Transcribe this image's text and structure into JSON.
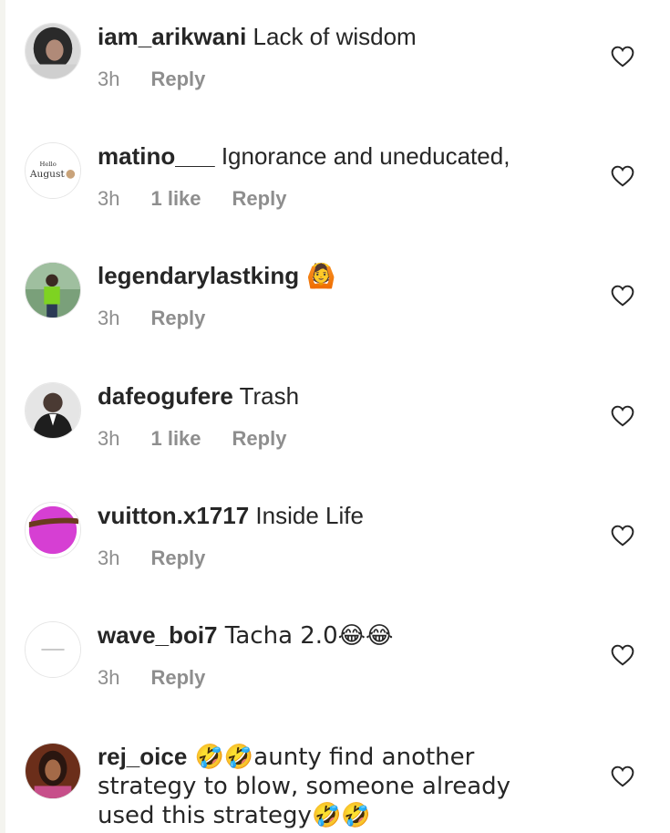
{
  "comments": [
    {
      "username": "iam_arikwani",
      "text": " Lack of wisdom",
      "time": "3h",
      "likes": "",
      "reply": "Reply",
      "avatar": "dark-hair-avatar"
    },
    {
      "username": "matino___",
      "text": " Ignorance and uneducated,",
      "time": "3h",
      "likes": "1 like",
      "reply": "Reply",
      "avatar": "hello-august-avatar",
      "avatar_text_1": "Hello",
      "avatar_text_2": "August"
    },
    {
      "username": "legendarylastking",
      "text": " 🙆",
      "time": "3h",
      "likes": "",
      "reply": "Reply",
      "avatar": "green-shirt-avatar"
    },
    {
      "username": "dafeogufere",
      "text": " Trash",
      "time": "3h",
      "likes": "1 like",
      "reply": "Reply",
      "avatar": "suit-man-avatar"
    },
    {
      "username": "vuitton.x1717",
      "text": " Inside Life",
      "time": "3h",
      "likes": "",
      "reply": "Reply",
      "avatar": "pink-circle-avatar"
    },
    {
      "username": "wave_boi7",
      "text": " Tacha 2.0😂😂",
      "time": "3h",
      "likes": "",
      "reply": "Reply",
      "avatar": "white-avatar"
    },
    {
      "username": "rej_oice",
      "text": " 🤣🤣aunty find another strategy to blow, someone already used this strategy🤣🤣",
      "time": "",
      "likes": "",
      "reply": "",
      "avatar": "woman-avatar"
    }
  ],
  "colors": {
    "text": "#262626",
    "muted": "#8e8e8e",
    "heart_stroke": "#262626"
  },
  "icons": {
    "like": "heart-outline-icon"
  }
}
